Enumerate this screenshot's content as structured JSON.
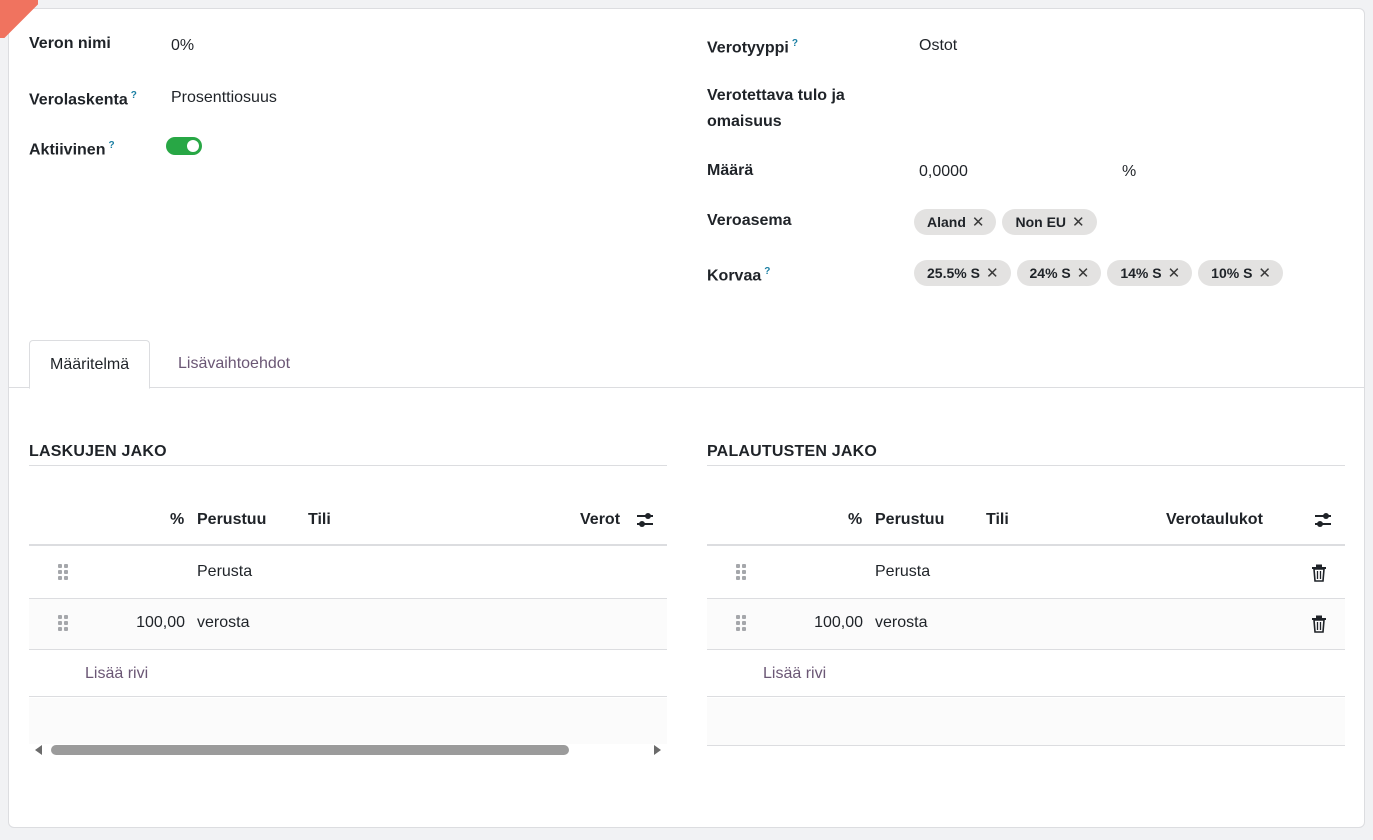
{
  "form": {
    "left": [
      {
        "label": "Veron nimi",
        "help": "",
        "value": "0%"
      },
      {
        "label": "Verolaskenta",
        "help": "?",
        "value": "Prosenttiosuus"
      },
      {
        "label": "Aktiivinen",
        "help": "?",
        "value": ""
      }
    ],
    "right": {
      "tax_type": {
        "label": "Verotyyppi",
        "help": "?",
        "value": "Ostot"
      },
      "taxable": {
        "label_line1": "Verotettava tulo ja",
        "label_line2": "omaisuus",
        "value": ""
      },
      "amount": {
        "label": "Määrä",
        "value": "0,0000",
        "unit": "%"
      },
      "fiscal_position": {
        "label": "Veroasema",
        "tags": [
          "Aland",
          "Non EU"
        ]
      },
      "replace": {
        "label": "Korvaa",
        "help": "?",
        "tags": [
          "25.5% S",
          "24% S",
          "14% S",
          "10% S"
        ]
      }
    },
    "active": true
  },
  "tabs": [
    {
      "label": "Määritelmä",
      "active": true
    },
    {
      "label": "Lisävaihtoehdot",
      "active": false
    }
  ],
  "invoice_distribution": {
    "title": "LASKUJEN JAKO",
    "columns": {
      "percent": "%",
      "based_on": "Perustuu",
      "account": "Tili",
      "tax_grids": "Verot"
    },
    "rows": [
      {
        "percent": "",
        "based_on": "Perusta"
      },
      {
        "percent": "100,00",
        "based_on": "verosta"
      }
    ],
    "add_line": "Lisää rivi"
  },
  "refund_distribution": {
    "title": "PALAUTUSTEN JAKO",
    "columns": {
      "percent": "%",
      "based_on": "Perustuu",
      "account": "Tili",
      "tax_grids": "Verotaulukot"
    },
    "rows": [
      {
        "percent": "",
        "based_on": "Perusta"
      },
      {
        "percent": "100,00",
        "based_on": "verosta"
      }
    ],
    "add_line": "Lisää rivi"
  },
  "icons": {
    "help": "question-mark-icon",
    "tag_remove": "close-icon",
    "column_settings": "sliders-icon",
    "row_handle": "drag-handle-icon",
    "delete_row": "trash-icon"
  },
  "colors": {
    "toggle_on": "#28a745",
    "link": "#6b5775",
    "tag_bg": "#e3e2e1",
    "help": "#1b7fa3"
  }
}
